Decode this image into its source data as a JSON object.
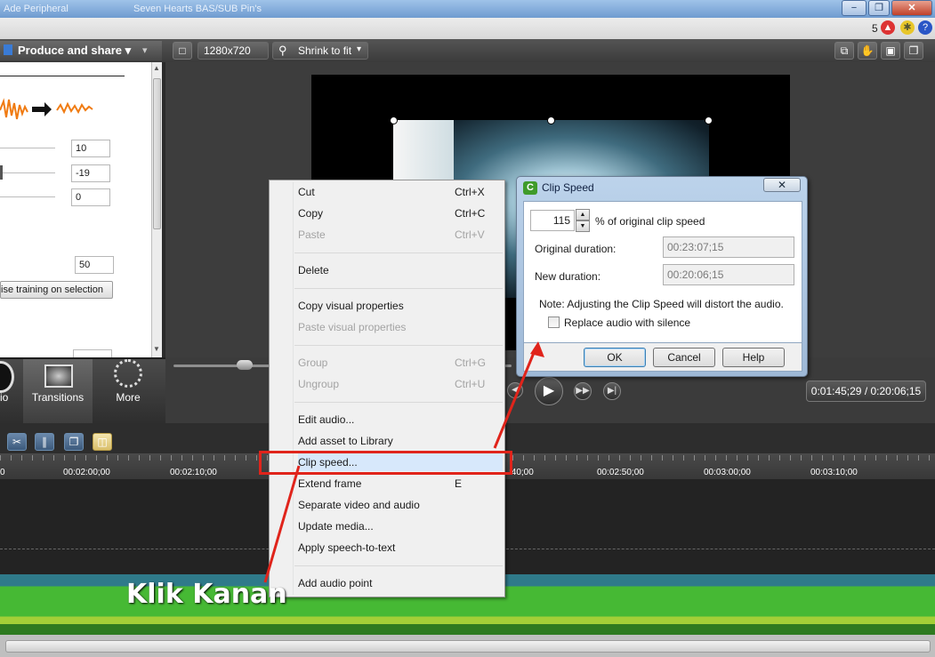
{
  "titlebar": {
    "tabs": [
      "Ade Peripheral",
      "Seven Hearts BAS/SUB Pin's"
    ],
    "minimize": "−",
    "restore": "❐",
    "close": "✕"
  },
  "statusbar": {
    "notification_count": "5"
  },
  "toolbar": {
    "produce_label": "Produce and share",
    "resolution": "1280x720",
    "zoom": "Shrink to fit"
  },
  "left_panel": {
    "fields": [
      "10",
      "-19",
      "0"
    ],
    "noise_value": "50",
    "noise_button": "ise training on selection"
  },
  "tabs": [
    {
      "label": "io"
    },
    {
      "label": "Transitions"
    },
    {
      "label": "More"
    }
  ],
  "playback": {
    "timecode": "0:01:45;29 / 0:20:06;15"
  },
  "timeline": {
    "ticks": [
      "0",
      "00:02:00;00",
      "00:02:10;00",
      ":40;00",
      "00:02:50;00",
      "00:03:00;00",
      "00:03:10;00"
    ]
  },
  "context_menu": {
    "items": [
      {
        "label": "Cut",
        "shortcut": "Ctrl+X"
      },
      {
        "label": "Copy",
        "shortcut": "Ctrl+C"
      },
      {
        "label": "Paste",
        "shortcut": "Ctrl+V"
      },
      {
        "label": "Delete",
        "shortcut": ""
      },
      {
        "label": "Copy visual properties",
        "shortcut": ""
      },
      {
        "label": "Paste visual properties",
        "shortcut": ""
      },
      {
        "label": "Group",
        "shortcut": "Ctrl+G"
      },
      {
        "label": "Ungroup",
        "shortcut": "Ctrl+U"
      },
      {
        "label": "Edit audio...",
        "shortcut": ""
      },
      {
        "label": "Add asset to Library",
        "shortcut": ""
      },
      {
        "label": "Clip speed...",
        "shortcut": ""
      },
      {
        "label": "Extend frame",
        "shortcut": "E"
      },
      {
        "label": "Separate video and audio",
        "shortcut": ""
      },
      {
        "label": "Update media...",
        "shortcut": ""
      },
      {
        "label": "Apply speech-to-text",
        "shortcut": ""
      },
      {
        "label": "Add audio point",
        "shortcut": ""
      }
    ]
  },
  "dialog": {
    "title": "Clip Speed",
    "speed_value": "115",
    "speed_suffix": "% of original clip speed",
    "original_label": "Original duration:",
    "original_value": "00:23:07;15",
    "new_label": "New duration:",
    "new_value": "00:20:06;15",
    "note": "Note: Adjusting the Clip Speed will distort the audio.",
    "checkbox_label": "Replace audio with silence",
    "ok": "OK",
    "cancel": "Cancel",
    "help": "Help"
  },
  "annotation": {
    "text": "Klik Kanan"
  },
  "colors": {
    "accent_red": "#e0241b",
    "audio_green": "#46b934",
    "audio_teal": "#2f7a8a"
  }
}
